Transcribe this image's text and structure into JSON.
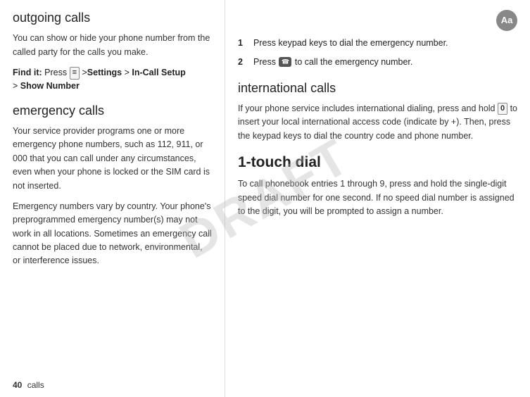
{
  "left": {
    "outgoing_calls": {
      "heading": "outgoing calls",
      "body1": "You can show or hide your phone number from the called party for the calls you make.",
      "find_it_label": "Find it:",
      "press_label": "Press",
      "menu_key": "≡",
      "separator1": ">",
      "settings": "Settings",
      "separator2": ">",
      "in_call_setup": "In-Call Setup",
      "separator3": ">",
      "show_number": "Show Number"
    },
    "emergency_calls": {
      "heading": "emergency calls",
      "body1": "Your service provider programs one or more emergency phone numbers, such as 112, 911, or 000 that you can call under any circumstances, even when your phone is locked or the SIM card is not inserted.",
      "body2": "Emergency numbers vary by country. Your phone's preprogrammed emergency number(s) may not work in all locations. Sometimes an emergency call cannot be placed due to network, environmental, or interference issues."
    }
  },
  "right": {
    "steps": [
      {
        "number": "1",
        "text": "Press keypad keys to dial the emergency number."
      },
      {
        "number": "2",
        "text": "Press  to call the emergency number."
      }
    ],
    "international_calls": {
      "heading": "international calls",
      "body": "If your phone service includes international dialing, press and hold  to insert your local international access code (indicate by +). Then, press the keypad keys to dial the country code and phone number."
    },
    "one_touch_dial": {
      "heading": "1-touch dial",
      "body": "To call phonebook entries 1 through 9, press and hold the single-digit speed dial number for one second. If no speed dial number is assigned to the digit, you will be prompted to assign a number."
    }
  },
  "footer": {
    "page_number": "40",
    "section_label": "calls"
  },
  "watermark": "DRAFT",
  "icon": {
    "label": "Aa"
  }
}
